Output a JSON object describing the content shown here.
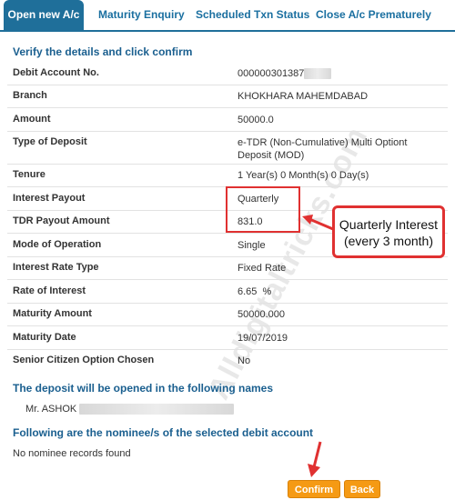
{
  "tabs": [
    {
      "label": "Open new A/c"
    },
    {
      "label": "Maturity Enquiry"
    },
    {
      "label": "Scheduled Txn Status"
    },
    {
      "label": "Close A/c Prematurely"
    }
  ],
  "verify_heading": "Verify the details and click confirm",
  "rows": [
    {
      "label": "Debit Account No.",
      "value": "000000301387"
    },
    {
      "label": "Branch",
      "value": "KHOKHARA MAHEMDABAD"
    },
    {
      "label": "Amount",
      "value": "50000.0"
    },
    {
      "label": "Type of Deposit",
      "value": "e-TDR (Non-Cumulative) Multi Optiont Deposit (MOD)"
    },
    {
      "label": "Tenure",
      "value": "1 Year(s) 0 Month(s) 0 Day(s)"
    },
    {
      "label": "Interest Payout",
      "value": "Quarterly"
    },
    {
      "label": "TDR Payout Amount",
      "value": "831.0"
    },
    {
      "label": "Mode of Operation",
      "value": "Single"
    },
    {
      "label": "Interest Rate Type",
      "value": "Fixed Rate"
    },
    {
      "label": "Rate of Interest",
      "value": "6.65  %"
    },
    {
      "label": "Maturity Amount",
      "value": "50000.000"
    },
    {
      "label": "Maturity Date",
      "value": "19/07/2019"
    },
    {
      "label": "Senior Citizen Option Chosen",
      "value": "No"
    }
  ],
  "callout": {
    "line1": "Quarterly Interest",
    "line2": "(every 3 month)"
  },
  "watermark": "Alldigitaltricks.com",
  "names_heading": "The deposit will be opened in the following names",
  "holder_name": "Mr. ASHOK",
  "nominee_heading": "Following are the nominee/s of the selected debit account",
  "nominee_text": "No nominee records found",
  "buttons": {
    "confirm": "Confirm",
    "back": "Back"
  },
  "colors": {
    "tab_active": "#1f6f9a",
    "heading": "#1a5f8f",
    "button": "#f59a14",
    "annotation": "#e03131"
  }
}
